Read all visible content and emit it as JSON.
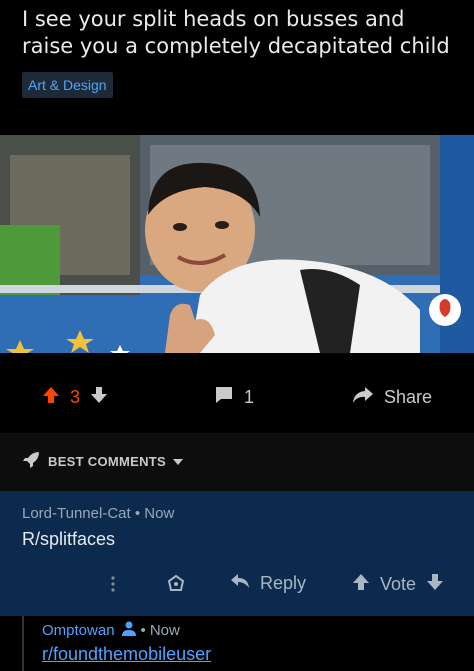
{
  "post": {
    "title": "I see your split heads on busses and raise you a completely decapitated child",
    "flair": "Art & Design"
  },
  "actions": {
    "upvotes": "3",
    "comments": "1",
    "share_label": "Share"
  },
  "comments_section": {
    "sort_label": "BEST COMMENTS"
  },
  "comment1": {
    "author": "Lord-Tunnel-Cat",
    "separator": "•",
    "time": "Now",
    "body": "R/splitfaces",
    "reply_label": "Reply",
    "vote_label": "Vote"
  },
  "comment2": {
    "author": "Omptowan",
    "separator": "•",
    "time": "Now",
    "body": "r/foundthemobileuser"
  },
  "colors": {
    "upvote": "#ff4500",
    "highlight_bg": "#0b2a4e",
    "link": "#4fa3ff"
  },
  "icons": [
    "arrow-up-icon",
    "arrow-down-icon",
    "comment-icon",
    "share-icon",
    "rocket-icon",
    "chevron-down-icon",
    "more-vertical-icon",
    "award-icon",
    "reply-icon",
    "person-icon"
  ]
}
